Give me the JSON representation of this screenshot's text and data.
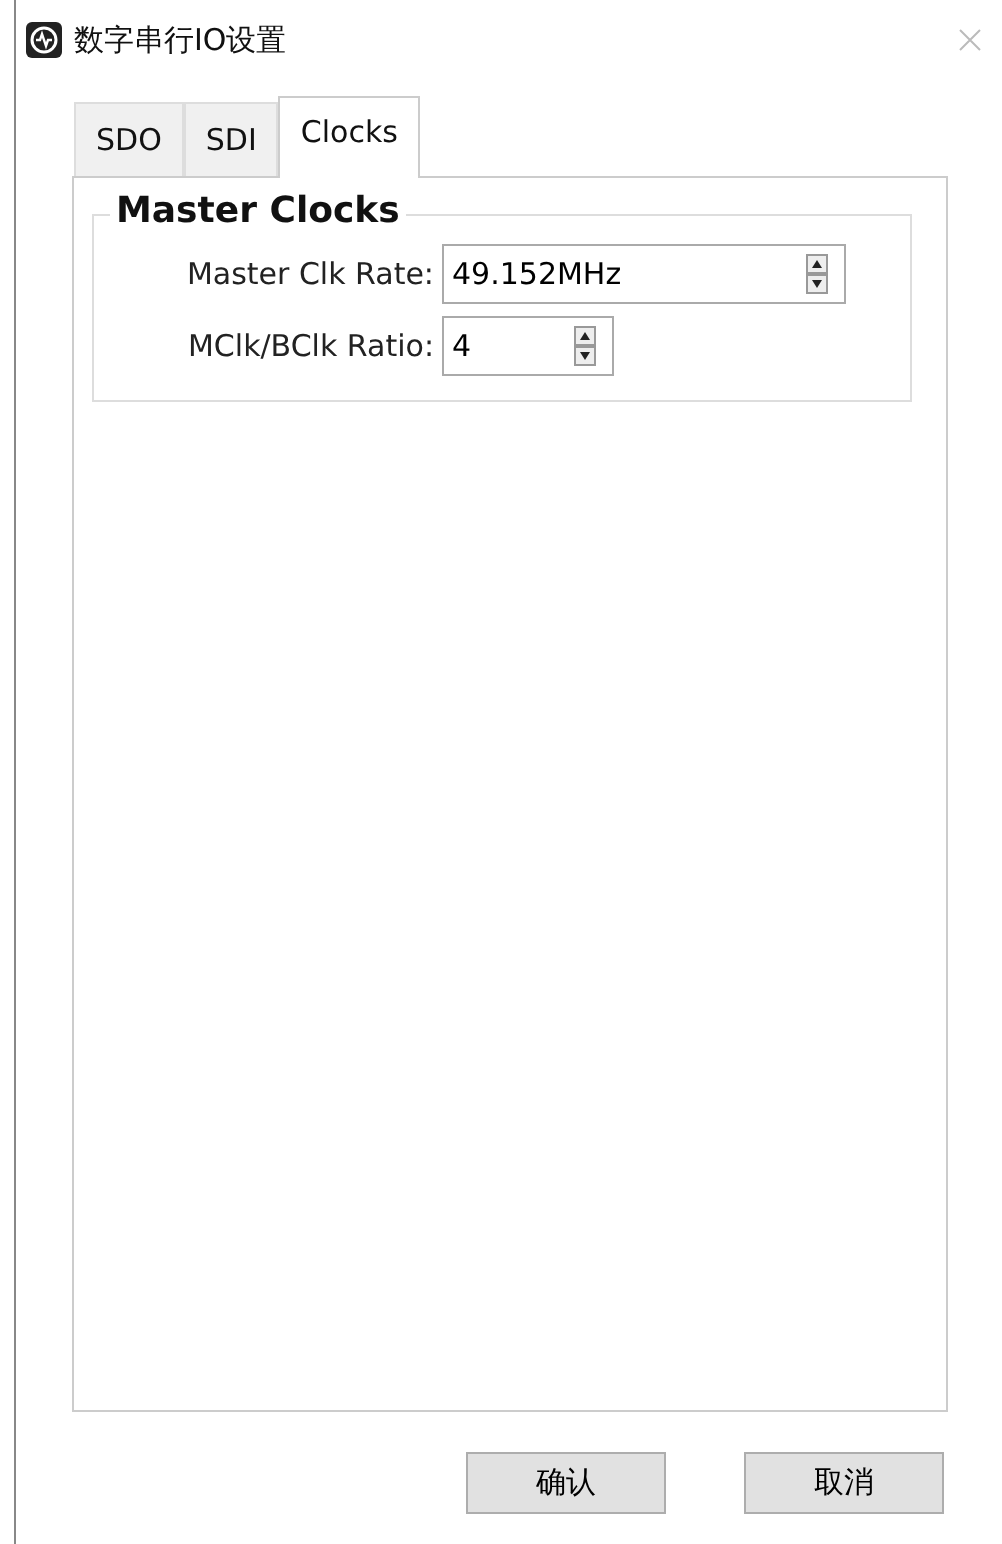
{
  "window": {
    "title": "数字串行IO设置"
  },
  "tabs": [
    {
      "label": "SDO",
      "selected": false
    },
    {
      "label": "SDI",
      "selected": false
    },
    {
      "label": "Clocks",
      "selected": true
    }
  ],
  "group": {
    "title": "Master Clocks",
    "fields": [
      {
        "label": "Master Clk Rate:",
        "value": "49.152MHz",
        "kind": "wide"
      },
      {
        "label": "MClk/BClk Ratio:",
        "value": "4",
        "kind": "narrow"
      }
    ]
  },
  "buttons": [
    "确认",
    "取消"
  ]
}
